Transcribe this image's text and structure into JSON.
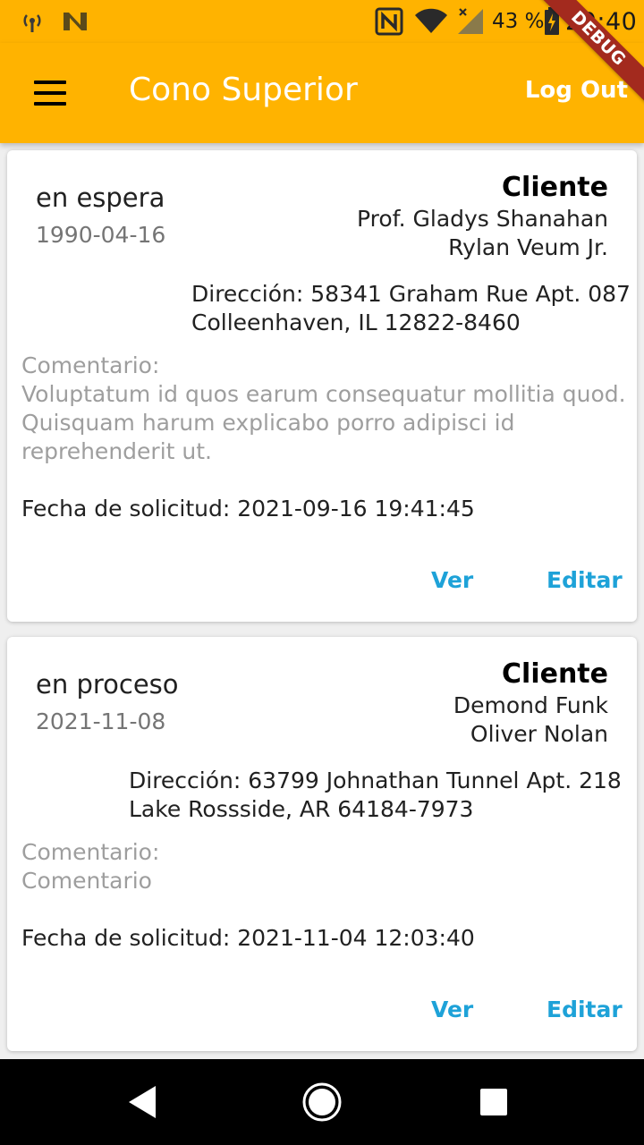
{
  "status_bar": {
    "battery": "43 %",
    "time": "20:40",
    "icons": [
      "cast-signal-icon",
      "n-notification-icon",
      "nfc-icon",
      "wifi-icon",
      "cell-signal-icon",
      "battery-charging-icon"
    ]
  },
  "debug_banner": "DEBUG",
  "app_bar": {
    "title": "Cono Superior",
    "logout_label": "Log Out",
    "menu_icon": "hamburger-menu-icon",
    "background": "#FFB300"
  },
  "requests": [
    {
      "status": "en espera",
      "date": "1990-04-16",
      "client_title": "Cliente",
      "client_lines": [
        "Prof. Gladys Shanahan",
        "Rylan Veum Jr."
      ],
      "address_lines": [
        "Dirección: 58341 Graham Rue Apt. 087",
        "Colleenhaven, IL 12822-8460"
      ],
      "comment_lines": [
        "Comentario:",
        "Voluptatum id quos earum consequatur mollitia quod.",
        "Quisquam harum explicabo porro adipisci id",
        "reprehenderit ut."
      ],
      "request_date": "Fecha de solicitud: 2021-09-16 19:41:45",
      "view_label": "Ver",
      "edit_label": "Editar"
    },
    {
      "status": "en proceso",
      "date": "2021-11-08",
      "client_title": "Cliente",
      "client_lines": [
        "Demond Funk",
        "Oliver Nolan"
      ],
      "address_lines": [
        "Dirección: 63799 Johnathan Tunnel Apt. 218",
        "Lake Rossside, AR 64184-7973"
      ],
      "comment_lines": [
        "Comentario:",
        "Comentario"
      ],
      "request_date": "Fecha de solicitud: 2021-11-04 12:03:40",
      "view_label": "Ver",
      "edit_label": "Editar"
    }
  ],
  "nav_bar": {
    "icons": [
      "back-icon",
      "home-icon",
      "recents-icon"
    ]
  },
  "colors": {
    "accent": "#FFB300",
    "link": "#1EA2D8",
    "debug": "#A32A1E"
  }
}
